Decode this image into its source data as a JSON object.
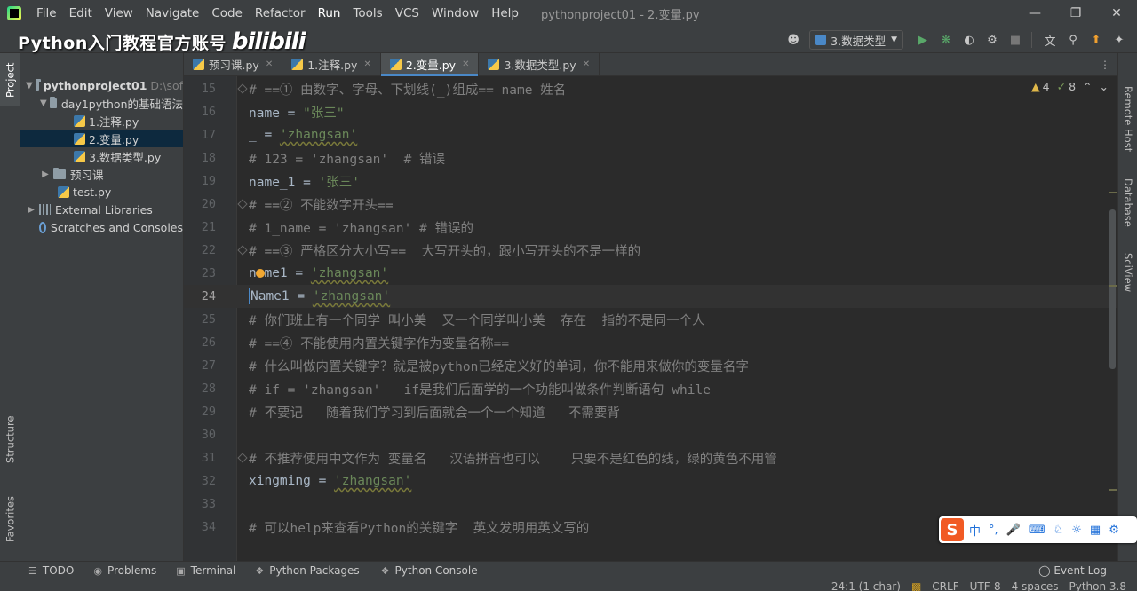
{
  "menubar": {
    "items": [
      "File",
      "Edit",
      "View",
      "Navigate",
      "Code",
      "Refactor",
      "Run",
      "Tools",
      "VCS",
      "Window",
      "Help"
    ],
    "window_title": "pythonproject01 - 2.变量.py",
    "minimize": "—",
    "restore": "❐",
    "close": "✕"
  },
  "watermark": {
    "text": "Python入门教程官方账号",
    "logo": "bilibili"
  },
  "toolbar": {
    "breadcrumb": "Python入门教程官方账号  2.变量.py",
    "run_config": "3.数据类型"
  },
  "left_strip": {
    "project": "Project",
    "structure": "Structure",
    "favorites": "Favorites"
  },
  "right_strip": {
    "remote_host": "Remote Host",
    "database": "Database",
    "sciview": "SciView"
  },
  "project_tree": {
    "root": "pythonproject01",
    "root_path": "D:\\sof",
    "folder1": "day1python的基础语法",
    "file1": "1.注释.py",
    "file2": "2.变量.py",
    "file3": "3.数据类型.py",
    "folder2": "预习课",
    "file4": "test.py",
    "external": "External Libraries",
    "scratches": "Scratches and Consoles"
  },
  "tabs": [
    {
      "label": "预习课.py"
    },
    {
      "label": "1.注释.py"
    },
    {
      "label": "2.变量.py"
    },
    {
      "label": "3.数据类型.py"
    }
  ],
  "inspections": {
    "warnings": "4",
    "weak": "8"
  },
  "code_lines": [
    {
      "n": "15",
      "text": "# ==① 由数字、字母、下划线(_)组成== name 姓名"
    },
    {
      "n": "16",
      "a": "name = ",
      "s": "\"张三\""
    },
    {
      "n": "17",
      "a": "_ = ",
      "s": "'zhangsan'"
    },
    {
      "n": "18",
      "text": "# 123 = 'zhangsan'  # 错误"
    },
    {
      "n": "19",
      "a": "name_1 = ",
      "s": "'张三'"
    },
    {
      "n": "20",
      "text": "# ==② 不能数字开头=="
    },
    {
      "n": "21",
      "text": "# 1_name = 'zhangsan' # 错误的"
    },
    {
      "n": "22",
      "text": "# ==③ 严格区分大小写==  大写开头的，跟小写开头的不是一样的"
    },
    {
      "n": "23",
      "a": "name1 = ",
      "s": "'zhangsan'"
    },
    {
      "n": "24",
      "a": "Name1 = ",
      "s": "'zhangsan'"
    },
    {
      "n": "25",
      "text": "# 你们班上有一个同学 叫小美  又一个同学叫小美  存在  指的不是同一个人"
    },
    {
      "n": "26",
      "text": "# ==④ 不能使用内置关键字作为变量名称=="
    },
    {
      "n": "27",
      "text": "# 什么叫做内置关键字？就是被python已经定义好的单词，你不能用来做你的变量名字"
    },
    {
      "n": "28",
      "text": "# if = 'zhangsan'   if是我们后面学的一个功能叫做条件判断语句 while"
    },
    {
      "n": "29",
      "text": "# 不要记   随着我们学习到后面就会一个一个知道   不需要背"
    },
    {
      "n": "30",
      "text": ""
    },
    {
      "n": "31",
      "text": "# 不推荐使用中文作为 变量名   汉语拼音也可以    只要不是红色的线，绿的黄色不用管"
    },
    {
      "n": "32",
      "a": "xingming = ",
      "s": "'zhangsan'"
    },
    {
      "n": "33",
      "text": ""
    },
    {
      "n": "34",
      "text": "# 可以help来查看Python的关键字  英文发明用英文写的"
    }
  ],
  "ime": {
    "logo": "S",
    "mode": "中",
    "punct": "°,"
  },
  "bottombar": {
    "todo": "TODO",
    "problems": "Problems",
    "terminal": "Terminal",
    "packages": "Python Packages",
    "console": "Python Console",
    "eventlog": "Event Log"
  },
  "statusbar": {
    "position": "24:1 (1 char)",
    "line_sep": "CRLF",
    "encoding": "UTF-8",
    "indent": "4 spaces",
    "interpreter": "Python 3.8"
  },
  "colors": {
    "accent": "#4a88c7",
    "comment": "#808080",
    "string": "#6a8759",
    "code": "#a9b7c6"
  }
}
